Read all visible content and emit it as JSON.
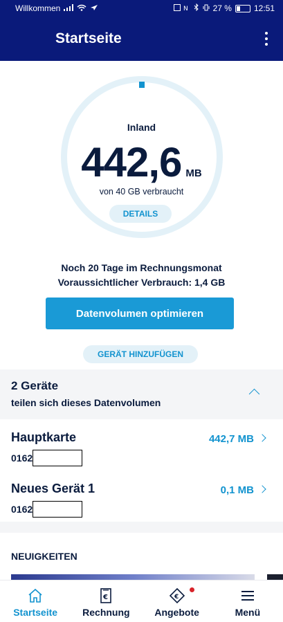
{
  "status_bar": {
    "carrier": "Willkommen",
    "battery": "27 %",
    "time": "12:51"
  },
  "app_bar": {
    "title": "Startseite"
  },
  "usage": {
    "label": "Inland",
    "value": "442,6",
    "unit": "MB",
    "subtitle": "von 40 GB verbraucht",
    "details_label": "DETAILS",
    "used_fraction": 0.011
  },
  "billing": {
    "days_line": "Noch 20 Tage im Rechnungsmonat",
    "forecast_prefix": "Voraussichtlicher Verbrauch: ",
    "forecast_value": "1,4 GB"
  },
  "actions": {
    "optimize_label": "Datenvolumen optimieren",
    "add_device_label": "GERÄT HINZUFÜGEN"
  },
  "devices": {
    "title": "2 Geräte",
    "subtitle": "teilen sich dieses Datenvolumen",
    "items": [
      {
        "name": "Hauptkarte",
        "number_prefix": "0162",
        "amount": "442,7 MB"
      },
      {
        "name": "Neues Gerät 1",
        "number_prefix": "0162",
        "amount": "0,1 MB"
      }
    ]
  },
  "news": {
    "title": "NEUIGKEITEN"
  },
  "nav": [
    {
      "label": "Startseite",
      "icon": "home-icon",
      "active": true
    },
    {
      "label": "Rechnung",
      "icon": "euro-document-icon"
    },
    {
      "label": "Angebote",
      "icon": "euro-tag-icon"
    },
    {
      "label": "Menü",
      "icon": "hamburger-menu-icon"
    }
  ],
  "colors": {
    "primary": "#0a1a7a",
    "accent": "#1293cf",
    "badge": "#d8232a"
  }
}
